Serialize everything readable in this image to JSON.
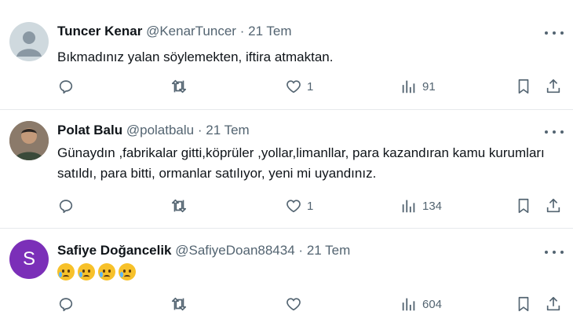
{
  "tweets": [
    {
      "name": "Tuncer Kenar",
      "handle": "@KenarTuncer",
      "dot": "·",
      "time": "21 Tem",
      "avatar_icon": "default-avatar-icon",
      "text": "Bıkmadınız yalan söylemekten, iftira atmaktan.",
      "likes": "1",
      "views": "91"
    },
    {
      "name": "Polat Balu",
      "handle": "@polatbalu",
      "dot": "·",
      "time": "21 Tem",
      "avatar_icon": "profile-photo-icon",
      "text": "Günaydın ,fabrikalar gitti,köprüler ,yollar,limanllar, para kazandıran kamu kurumları satıldı, para bitti, ormanlar satılıyor, yeni mi uyandınız.",
      "likes": "1",
      "views": "134"
    },
    {
      "name": "Safiye Doğancelik",
      "handle": "@SafiyeDoan88434",
      "dot": "·",
      "time": "21 Tem",
      "avatar_letter": "S",
      "avatar_color": "#7b2fb8",
      "emoji": [
        "crying-face-emoji",
        "crying-face-emoji",
        "crying-face-emoji",
        "crying-face-emoji"
      ],
      "likes": "",
      "views": "604"
    }
  ],
  "icons": {
    "reply": "reply-icon",
    "retweet": "retweet-icon",
    "like": "heart-icon",
    "views": "views-chart-icon",
    "bookmark": "bookmark-icon",
    "share": "share-icon",
    "more": "more-icon"
  },
  "colors": {
    "text": "#0f1419",
    "secondary": "#536471",
    "divider": "#e6e9ec"
  }
}
